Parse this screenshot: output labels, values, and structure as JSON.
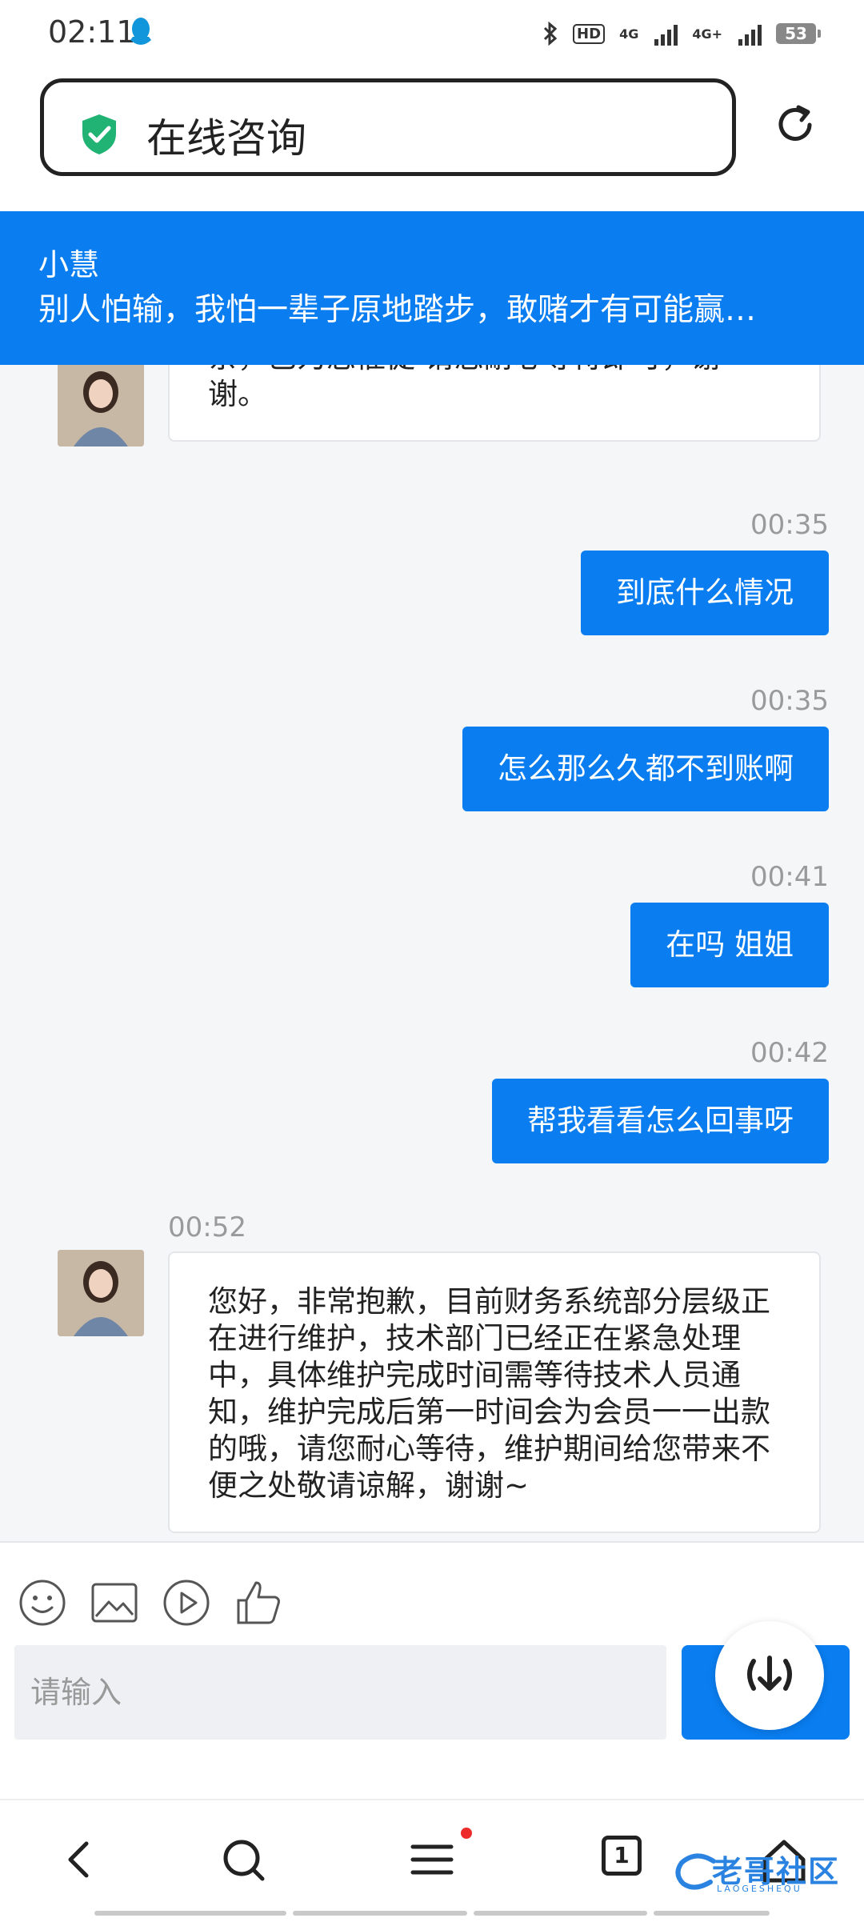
{
  "status_bar": {
    "time": "02:11",
    "network_1": "4G",
    "network_2": "4G+",
    "hd": "HD",
    "battery": "53"
  },
  "header": {
    "title": "在线咨询"
  },
  "banner": {
    "agent_name": "小慧",
    "message": "别人怕输，我怕一辈子原地踏步，敢赌才有可能赢…"
  },
  "messages": [
    {
      "side": "in",
      "text": "亲，已为您催促 请您耐心等待即可，谢谢。"
    },
    {
      "side": "out",
      "time": "00:35",
      "text": "到底什么情况"
    },
    {
      "side": "out",
      "time": "00:35",
      "text": "怎么那么久都不到账啊"
    },
    {
      "side": "out",
      "time": "00:41",
      "text": "在吗 姐姐"
    },
    {
      "side": "out",
      "time": "00:42",
      "text": "帮我看看怎么回事呀"
    },
    {
      "side": "in",
      "time": "00:52",
      "text": "您好，非常抱歉，目前财务系统部分层级正在进行维护，技术部门已经正在紧急处理中，具体维护完成时间需等待技术人员通知，维护完成后第一时间会为会员一一出款的哦，请您耐心等待，维护期间给您带来不便之处敬请谅解，谢谢~"
    }
  ],
  "input": {
    "placeholder": "请输入"
  },
  "nav": {
    "tab_count": "1"
  },
  "watermark": {
    "text": "老哥社区",
    "sub": "LAOGESHEQU"
  },
  "colors": {
    "accent": "#0a7df0",
    "shield": "#21b373",
    "badge": "#ee2b2b"
  }
}
